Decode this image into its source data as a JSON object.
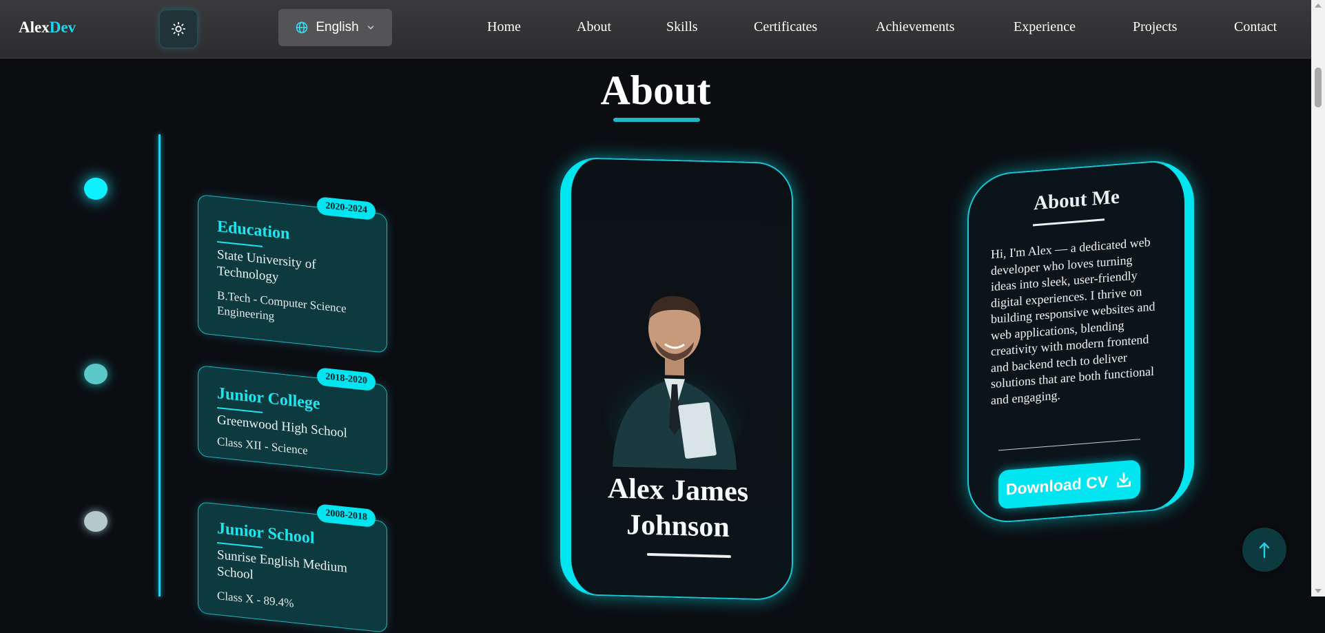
{
  "navbar": {
    "logo_part1": "Alex",
    "logo_part2": "Dev",
    "theme_toggle_icon": "sun-icon",
    "language": {
      "selected": "English",
      "icon": "globe-icon",
      "chevron": "chevron-down-icon"
    },
    "links": [
      "Home",
      "About",
      "Skills",
      "Certificates",
      "Achievements",
      "Experience",
      "Projects",
      "Contact"
    ]
  },
  "section": {
    "title": "About"
  },
  "timeline": [
    {
      "period": "2020-2024",
      "title": "Education",
      "school": "State University of Technology",
      "detail": "B.Tech - Computer Science Engineering"
    },
    {
      "period": "2018-2020",
      "title": "Junior College",
      "school": "Greenwood High School",
      "detail": "Class XII - Science"
    },
    {
      "period": "2008-2018",
      "title": "Junior School",
      "school": "Sunrise English Medium School",
      "detail": "Class X - 89.4%"
    }
  ],
  "profile": {
    "name_line1": "Alex James",
    "name_line2": "Johnson"
  },
  "about_me": {
    "heading": "About Me",
    "text": "Hi, I'm Alex — a dedicated web developer who loves turning ideas into sleek, user-friendly digital experiences. I thrive on building responsive websites and web applications, blending creativity with modern frontend and backend tech to deliver solutions that are both functional and engaging.",
    "download_label": "Download CV",
    "download_icon": "download-icon"
  },
  "scroll_top": {
    "icon": "arrow-up-icon",
    "label": "↑"
  },
  "colors": {
    "accent": "#00e5f0",
    "background": "#0b0d11",
    "navbar": "#333335"
  }
}
